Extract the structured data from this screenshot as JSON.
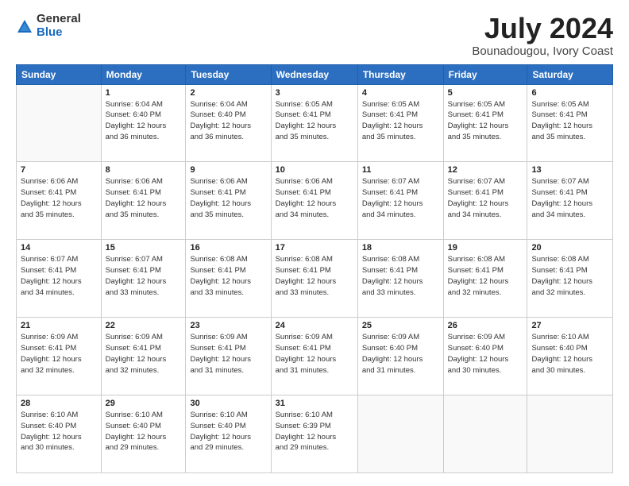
{
  "logo": {
    "general": "General",
    "blue": "Blue"
  },
  "header": {
    "month": "July 2024",
    "location": "Bounadougou, Ivory Coast"
  },
  "weekdays": [
    "Sunday",
    "Monday",
    "Tuesday",
    "Wednesday",
    "Thursday",
    "Friday",
    "Saturday"
  ],
  "weeks": [
    [
      {
        "day": "",
        "sunrise": "",
        "sunset": "",
        "daylight": ""
      },
      {
        "day": "1",
        "sunrise": "6:04 AM",
        "sunset": "6:40 PM",
        "daylight": "12 hours and 36 minutes."
      },
      {
        "day": "2",
        "sunrise": "6:04 AM",
        "sunset": "6:40 PM",
        "daylight": "12 hours and 36 minutes."
      },
      {
        "day": "3",
        "sunrise": "6:05 AM",
        "sunset": "6:41 PM",
        "daylight": "12 hours and 35 minutes."
      },
      {
        "day": "4",
        "sunrise": "6:05 AM",
        "sunset": "6:41 PM",
        "daylight": "12 hours and 35 minutes."
      },
      {
        "day": "5",
        "sunrise": "6:05 AM",
        "sunset": "6:41 PM",
        "daylight": "12 hours and 35 minutes."
      },
      {
        "day": "6",
        "sunrise": "6:05 AM",
        "sunset": "6:41 PM",
        "daylight": "12 hours and 35 minutes."
      }
    ],
    [
      {
        "day": "7",
        "sunrise": "6:06 AM",
        "sunset": "6:41 PM",
        "daylight": "12 hours and 35 minutes."
      },
      {
        "day": "8",
        "sunrise": "6:06 AM",
        "sunset": "6:41 PM",
        "daylight": "12 hours and 35 minutes."
      },
      {
        "day": "9",
        "sunrise": "6:06 AM",
        "sunset": "6:41 PM",
        "daylight": "12 hours and 35 minutes."
      },
      {
        "day": "10",
        "sunrise": "6:06 AM",
        "sunset": "6:41 PM",
        "daylight": "12 hours and 34 minutes."
      },
      {
        "day": "11",
        "sunrise": "6:07 AM",
        "sunset": "6:41 PM",
        "daylight": "12 hours and 34 minutes."
      },
      {
        "day": "12",
        "sunrise": "6:07 AM",
        "sunset": "6:41 PM",
        "daylight": "12 hours and 34 minutes."
      },
      {
        "day": "13",
        "sunrise": "6:07 AM",
        "sunset": "6:41 PM",
        "daylight": "12 hours and 34 minutes."
      }
    ],
    [
      {
        "day": "14",
        "sunrise": "6:07 AM",
        "sunset": "6:41 PM",
        "daylight": "12 hours and 34 minutes."
      },
      {
        "day": "15",
        "sunrise": "6:07 AM",
        "sunset": "6:41 PM",
        "daylight": "12 hours and 33 minutes."
      },
      {
        "day": "16",
        "sunrise": "6:08 AM",
        "sunset": "6:41 PM",
        "daylight": "12 hours and 33 minutes."
      },
      {
        "day": "17",
        "sunrise": "6:08 AM",
        "sunset": "6:41 PM",
        "daylight": "12 hours and 33 minutes."
      },
      {
        "day": "18",
        "sunrise": "6:08 AM",
        "sunset": "6:41 PM",
        "daylight": "12 hours and 33 minutes."
      },
      {
        "day": "19",
        "sunrise": "6:08 AM",
        "sunset": "6:41 PM",
        "daylight": "12 hours and 32 minutes."
      },
      {
        "day": "20",
        "sunrise": "6:08 AM",
        "sunset": "6:41 PM",
        "daylight": "12 hours and 32 minutes."
      }
    ],
    [
      {
        "day": "21",
        "sunrise": "6:09 AM",
        "sunset": "6:41 PM",
        "daylight": "12 hours and 32 minutes."
      },
      {
        "day": "22",
        "sunrise": "6:09 AM",
        "sunset": "6:41 PM",
        "daylight": "12 hours and 32 minutes."
      },
      {
        "day": "23",
        "sunrise": "6:09 AM",
        "sunset": "6:41 PM",
        "daylight": "12 hours and 31 minutes."
      },
      {
        "day": "24",
        "sunrise": "6:09 AM",
        "sunset": "6:41 PM",
        "daylight": "12 hours and 31 minutes."
      },
      {
        "day": "25",
        "sunrise": "6:09 AM",
        "sunset": "6:40 PM",
        "daylight": "12 hours and 31 minutes."
      },
      {
        "day": "26",
        "sunrise": "6:09 AM",
        "sunset": "6:40 PM",
        "daylight": "12 hours and 30 minutes."
      },
      {
        "day": "27",
        "sunrise": "6:10 AM",
        "sunset": "6:40 PM",
        "daylight": "12 hours and 30 minutes."
      }
    ],
    [
      {
        "day": "28",
        "sunrise": "6:10 AM",
        "sunset": "6:40 PM",
        "daylight": "12 hours and 30 minutes."
      },
      {
        "day": "29",
        "sunrise": "6:10 AM",
        "sunset": "6:40 PM",
        "daylight": "12 hours and 29 minutes."
      },
      {
        "day": "30",
        "sunrise": "6:10 AM",
        "sunset": "6:40 PM",
        "daylight": "12 hours and 29 minutes."
      },
      {
        "day": "31",
        "sunrise": "6:10 AM",
        "sunset": "6:39 PM",
        "daylight": "12 hours and 29 minutes."
      },
      {
        "day": "",
        "sunrise": "",
        "sunset": "",
        "daylight": ""
      },
      {
        "day": "",
        "sunrise": "",
        "sunset": "",
        "daylight": ""
      },
      {
        "day": "",
        "sunrise": "",
        "sunset": "",
        "daylight": ""
      }
    ]
  ]
}
